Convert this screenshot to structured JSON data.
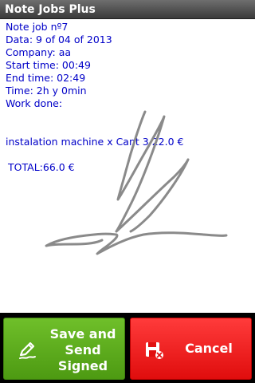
{
  "app": {
    "title": "Note Jobs Plus"
  },
  "note": {
    "heading": "Note job nº7",
    "date": "Data: 9 of 04 of 2013",
    "company": "Company: aa",
    "start_time": "Start time: 00:49",
    "end_time": "End time: 02:49",
    "duration": "Time: 2h y 0min",
    "work_done_label": "Work done:",
    "item_line": "instalation machine x Cant 3 22.0 €",
    "total": "TOTAL:66.0  €"
  },
  "actions": {
    "save_label": "Save and\nSend\nSigned",
    "save_icon": "pen-signature-icon",
    "cancel_label": "Cancel",
    "cancel_icon": "floppy-delete-icon"
  },
  "colors": {
    "text": "#0000c8",
    "signature_stroke": "#8a8a8a",
    "save_button": "#5aa81b",
    "cancel_button": "#f21c1c"
  }
}
